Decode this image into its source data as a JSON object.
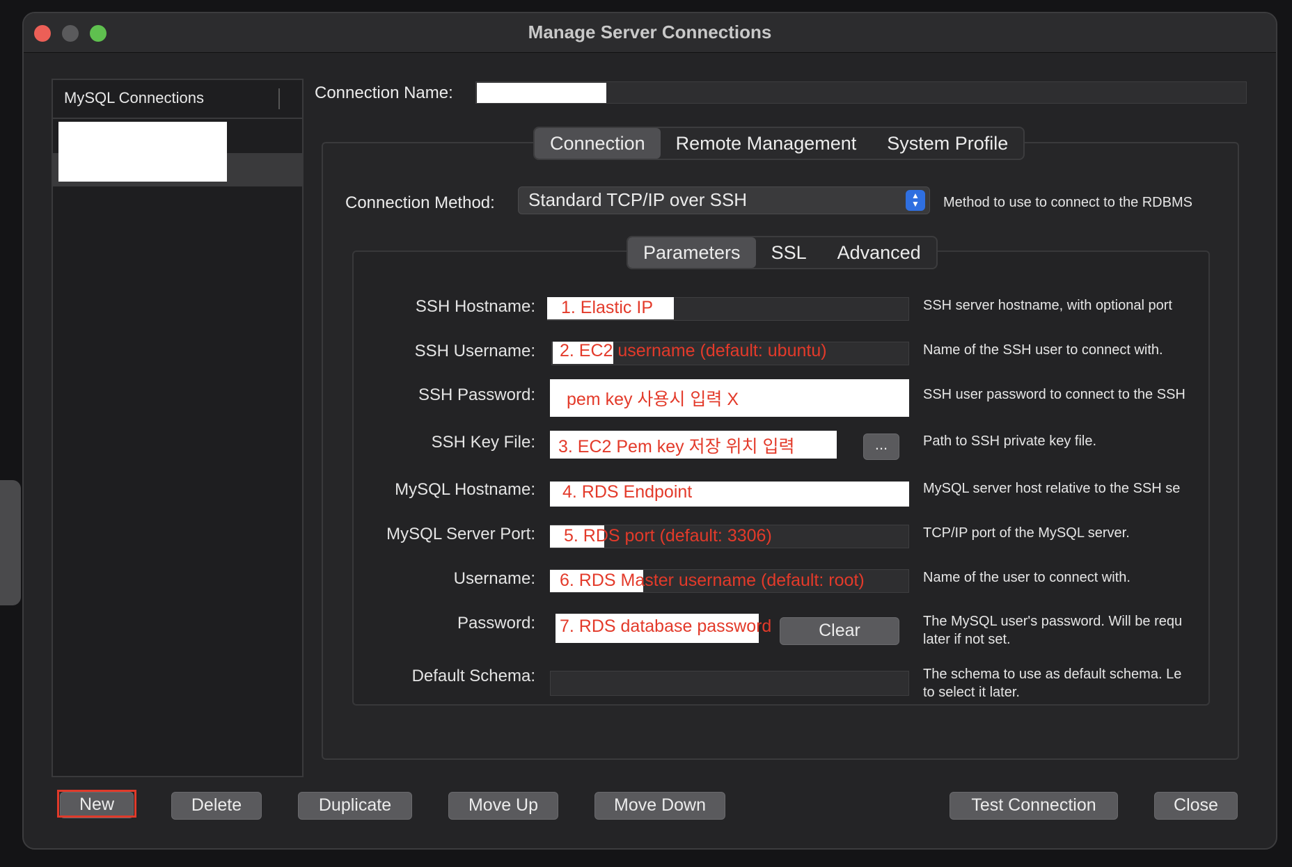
{
  "window": {
    "title": "Manage Server Connections"
  },
  "sidebar": {
    "header_label": "MySQL Connections"
  },
  "connection_name": {
    "label": "Connection Name:",
    "value": ""
  },
  "tabs": [
    {
      "label": "Connection",
      "active": true
    },
    {
      "label": "Remote Management",
      "active": false
    },
    {
      "label": "System Profile",
      "active": false
    }
  ],
  "connection_method": {
    "label": "Connection Method:",
    "value": "Standard TCP/IP over SSH",
    "description": "Method to use to connect to the RDBMS"
  },
  "subtabs": [
    {
      "label": "Parameters",
      "active": true
    },
    {
      "label": "SSL",
      "active": false
    },
    {
      "label": "Advanced",
      "active": false
    }
  ],
  "fields": {
    "ssh_hostname": {
      "label": "SSH Hostname:",
      "value": "1. Elastic IP",
      "description": "SSH server hostname, with  optional port"
    },
    "ssh_username": {
      "label": "SSH Username:",
      "value": "2. EC2 username (default: ubuntu)",
      "description": "Name of the SSH user to connect with."
    },
    "ssh_password": {
      "label": "SSH Password:",
      "value": "pem key 사용시 입력 X",
      "description": "SSH user password to connect to the SSH"
    },
    "ssh_key_file": {
      "label": "SSH Key File:",
      "value": "3. EC2 Pem key 저장 위치 입력",
      "browse_label": "...",
      "description": "Path to SSH private key file."
    },
    "mysql_hostname": {
      "label": "MySQL Hostname:",
      "value": "4. RDS Endpoint",
      "description": "MySQL server host relative to the SSH se"
    },
    "mysql_port": {
      "label": "MySQL Server Port:",
      "value": "5. RDS port (default: 3306)",
      "description": "TCP/IP port of the MySQL server."
    },
    "username": {
      "label": "Username:",
      "value": "6. RDS Master username (default: root)",
      "description": "Name of the user to connect with."
    },
    "password": {
      "label": "Password:",
      "value": "7. RDS database password",
      "clear_label": "Clear",
      "description_line1": "The MySQL user's password. Will be requ",
      "description_line2": "later if not set."
    },
    "default_schema": {
      "label": "Default Schema:",
      "value": "",
      "description_line1": "The schema to use as default schema. Le",
      "description_line2": "to select it later."
    }
  },
  "buttons": {
    "new": "New",
    "delete": "Delete",
    "duplicate": "Duplicate",
    "move_up": "Move Up",
    "move_down": "Move Down",
    "test_connection": "Test Connection",
    "close": "Close"
  },
  "colors": {
    "annotation_red": "#e33a2a",
    "accent_blue": "#2f6fe0",
    "highlight_outline": "#e03a2a"
  }
}
